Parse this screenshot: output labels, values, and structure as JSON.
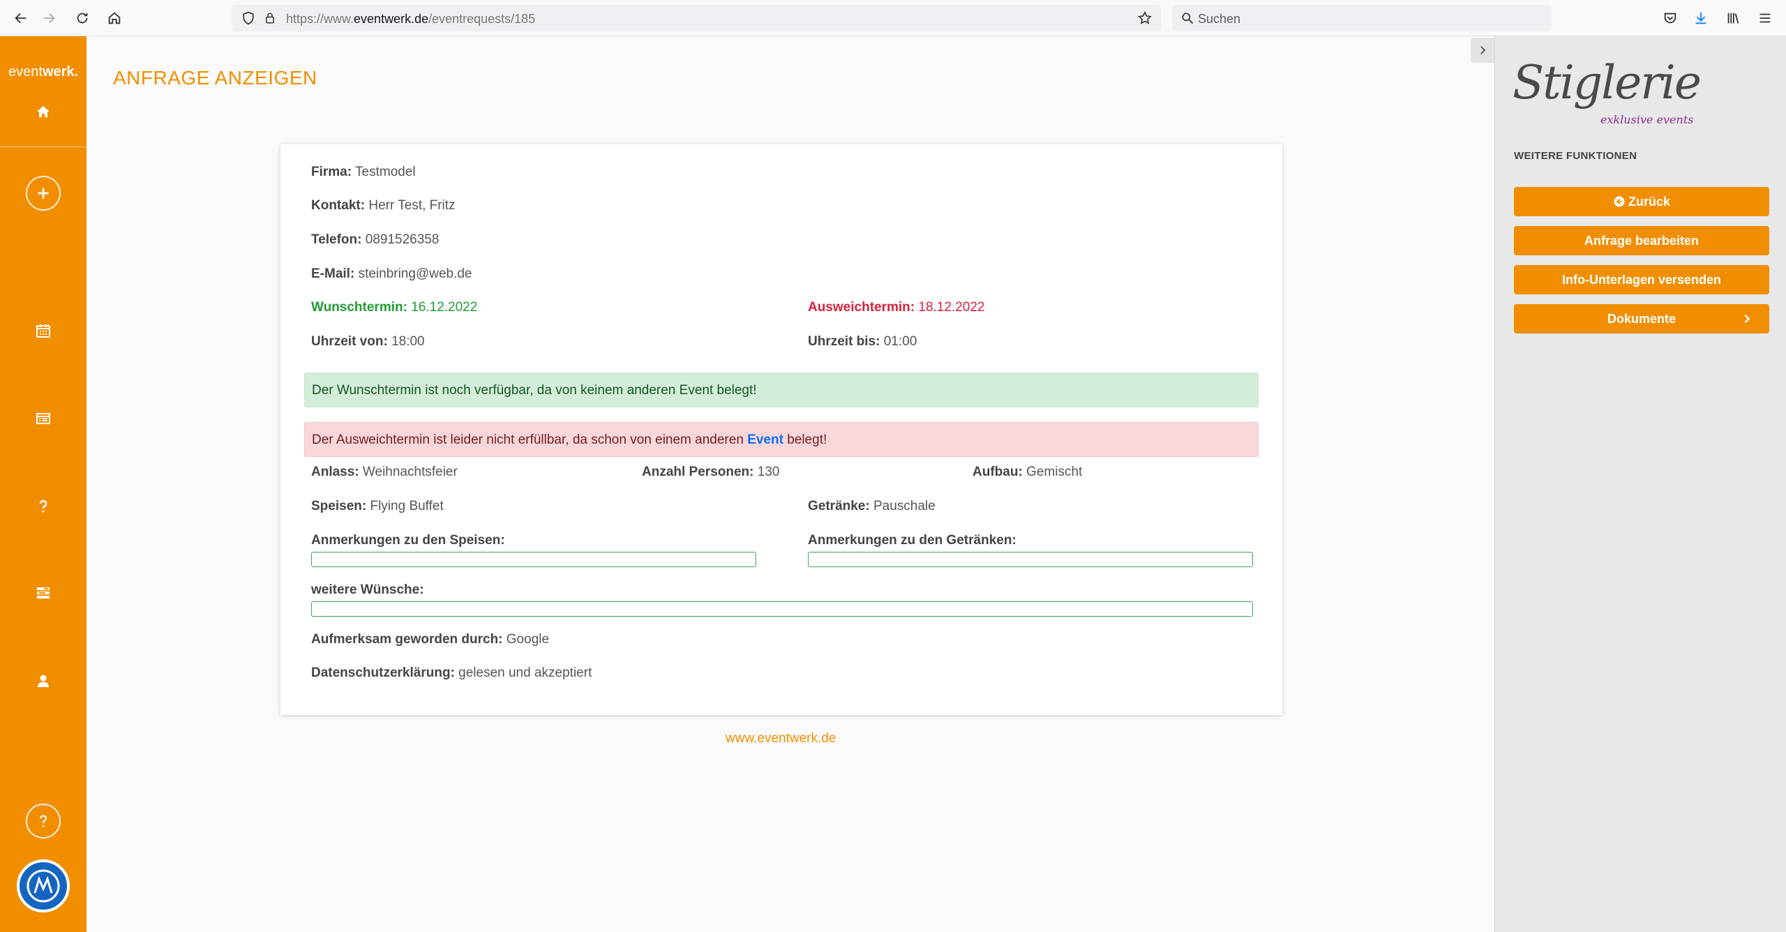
{
  "browser": {
    "url_prefix": "https://www.",
    "url_domain": "eventwerk.de",
    "url_path": "/eventrequests/185",
    "search_placeholder": "Suchen"
  },
  "sidebar": {
    "brand_light": "event",
    "brand_bold": "werk.",
    "nav_icons": [
      "home-icon",
      "add-icon",
      "calendar-icon",
      "list-icon",
      "help-icon",
      "tasks-icon",
      "user-icon",
      "help-circle-icon"
    ]
  },
  "page": {
    "title": "ANFRAGE ANZEIGEN",
    "footer_link": "www.eventwerk.de"
  },
  "request": {
    "firma": {
      "label": "Firma:",
      "value": "Testmodel"
    },
    "kontakt": {
      "label": "Kontakt:",
      "value": "Herr Test, Fritz"
    },
    "telefon": {
      "label": "Telefon:",
      "value": "0891526358"
    },
    "email": {
      "label": "E-Mail:",
      "value": "steinbring@web.de"
    },
    "wunschtermin": {
      "label": "Wunschtermin:",
      "value": "16.12.2022"
    },
    "ausweichtermin": {
      "label": "Ausweichtermin:",
      "value": "18.12.2022"
    },
    "uhrzeit_von": {
      "label": "Uhrzeit von:",
      "value": "18:00"
    },
    "uhrzeit_bis": {
      "label": "Uhrzeit bis:",
      "value": "01:00"
    },
    "alert_success": "Der Wunschtermin ist noch verfügbar, da von keinem anderen Event belegt!",
    "alert_danger_before": "Der Ausweichtermin ist leider nicht erfüllbar, da schon von einem anderen ",
    "alert_danger_link": "Event",
    "alert_danger_after": " belegt!",
    "anlass": {
      "label": "Anlass:",
      "value": "Weihnachtsfeier"
    },
    "personen": {
      "label": "Anzahl Personen:",
      "value": "130"
    },
    "aufbau": {
      "label": "Aufbau:",
      "value": "Gemischt"
    },
    "speisen": {
      "label": "Speisen:",
      "value": "Flying Buffet"
    },
    "getraenke": {
      "label": "Getränke:",
      "value": "Pauschale"
    },
    "anm_speisen_label": "Anmerkungen zu den Speisen:",
    "anm_getraenke_label": "Anmerkungen zu den Getränken:",
    "wuensche_label": "weitere Wünsche:",
    "aufmerksam": {
      "label": "Aufmerksam geworden durch:",
      "value": "Google"
    },
    "datenschutz": {
      "label": "Datenschutzerklärung:",
      "value": "gelesen und akzeptiert"
    }
  },
  "right_panel": {
    "logo_text": "Stiglerie",
    "logo_sub": "exklusive events",
    "heading": "WEITERE FUNKTIONEN",
    "buttons": [
      "Zurück",
      "Anfrage bearbeiten",
      "Info-Unterlagen versenden",
      "Dokumente"
    ]
  },
  "colors": {
    "accent": "#f18e00",
    "success": "#1f9d33",
    "danger": "#d9213b",
    "link": "#0d6efd"
  }
}
